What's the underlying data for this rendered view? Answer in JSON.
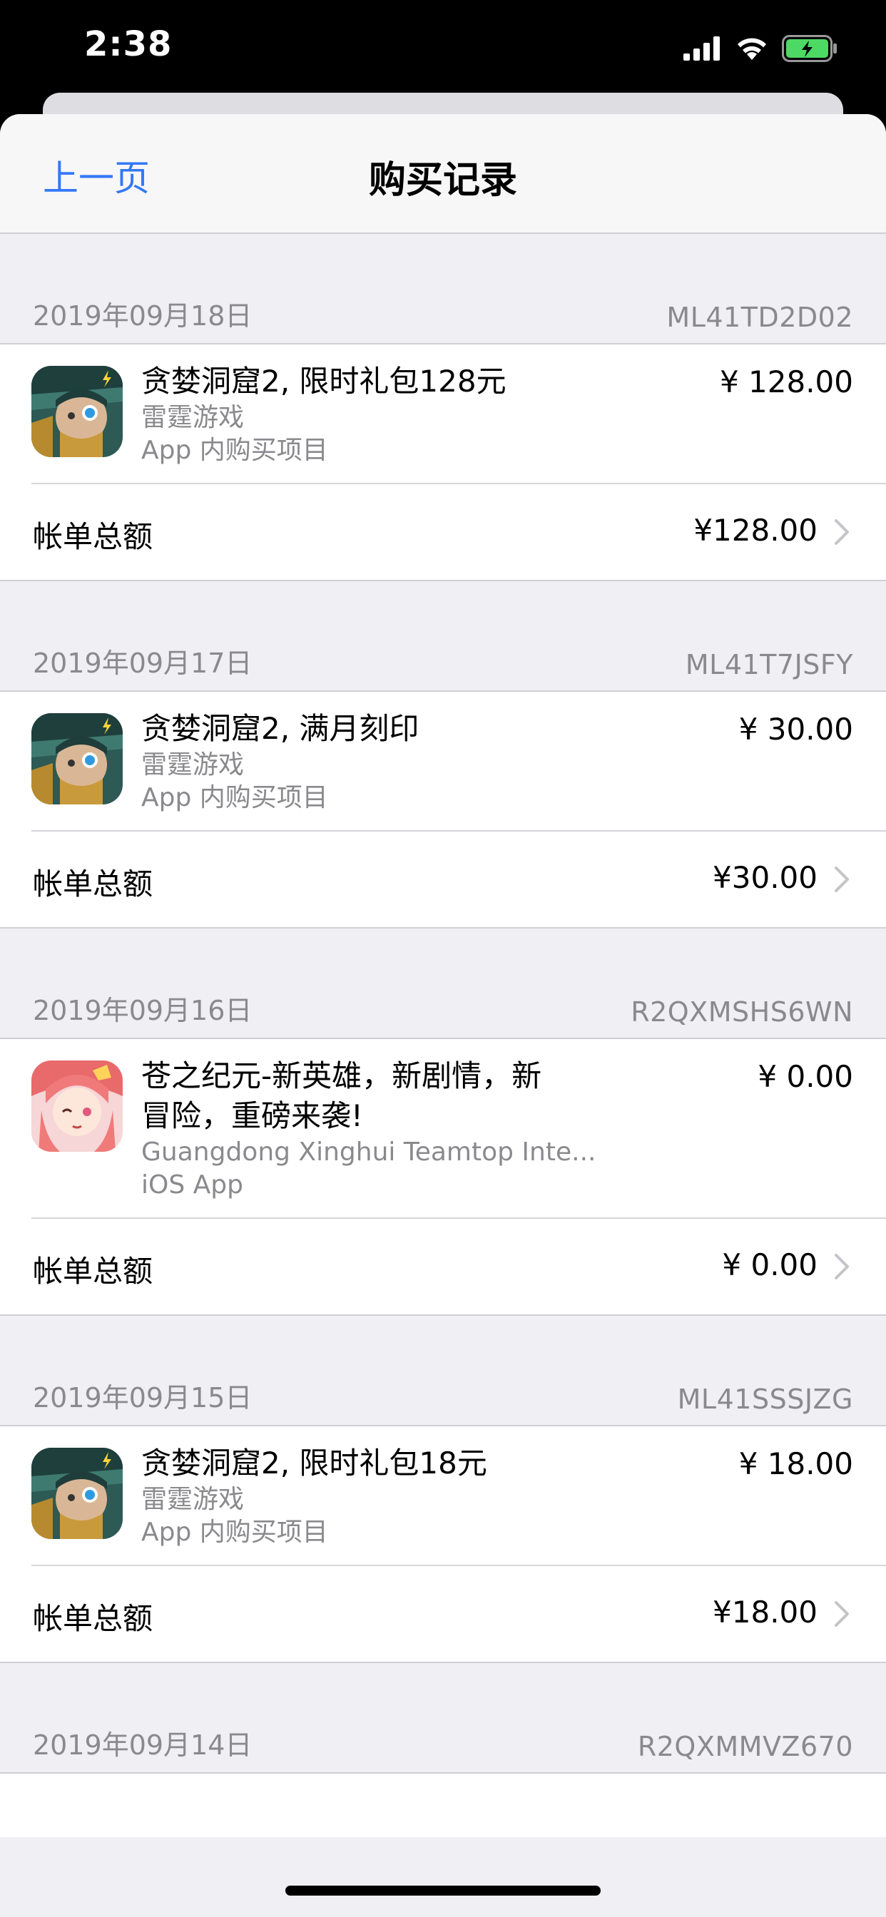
{
  "status_bar": {
    "time": "2:38",
    "battery_color": "#4cd964"
  },
  "nav": {
    "back_label": "上一页",
    "title": "购买记录",
    "accent_color": "#3478f6"
  },
  "sections": [
    {
      "date": "2019年09月18日",
      "order_id": "ML41TD2D02",
      "item": {
        "icon": "game-icon-tanlou",
        "title": "贪婪洞窟2, 限时礼包128元",
        "developer": "雷霆游戏",
        "type": "App 内购买项目",
        "price": "¥ 128.00"
      },
      "total_label": "帐单总额",
      "total_value": "¥128.00"
    },
    {
      "date": "2019年09月17日",
      "order_id": "ML41T7JSFY",
      "item": {
        "icon": "game-icon-tanlou",
        "title": "贪婪洞窟2, 满月刻印",
        "developer": "雷霆游戏",
        "type": "App 内购买项目",
        "price": "¥ 30.00"
      },
      "total_label": "帐单总额",
      "total_value": "¥30.00"
    },
    {
      "date": "2019年09月16日",
      "order_id": "R2QXMSHS6WN",
      "item": {
        "icon": "game-icon-cangzhijiyuan",
        "title_line1": "苍之纪元-新英雄，新剧情，新",
        "title_line2": "冒险，重磅来袭!",
        "developer": "Guangdong Xinghui Teamtop Inte...",
        "type": "iOS App",
        "price": "¥ 0.00"
      },
      "total_label": "帐单总额",
      "total_value": "¥ 0.00"
    },
    {
      "date": "2019年09月15日",
      "order_id": "ML41SSSJZG",
      "item": {
        "icon": "game-icon-tanlou",
        "title": "贪婪洞窟2, 限时礼包18元",
        "developer": "雷霆游戏",
        "type": "App 内购买项目",
        "price": "¥ 18.00"
      },
      "total_label": "帐单总额",
      "total_value": "¥18.00"
    },
    {
      "date": "2019年09月14日",
      "order_id": "R2QXMMVZ670"
    }
  ]
}
